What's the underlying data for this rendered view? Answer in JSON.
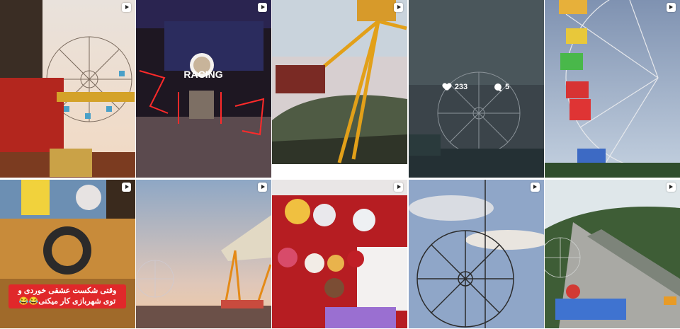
{
  "grid": {
    "tiles": [
      {
        "id": "t1",
        "subject": "ferris wheel and ride close-up",
        "is_reel": true
      },
      {
        "id": "t2",
        "subject": "racing arcade entrance neon",
        "is_reel": true,
        "sign_text": "RACING"
      },
      {
        "id": "t3",
        "subject": "pendulum swing ride",
        "is_reel": true
      },
      {
        "id": "t4",
        "subject": "ferris wheel at dusk",
        "is_reel": false,
        "likes": "233",
        "comments": "5"
      },
      {
        "id": "t5",
        "subject": "colorful ferris wheel cabins",
        "is_reel": true
      },
      {
        "id": "t6",
        "subject": "arcade driving game",
        "is_reel": true,
        "caption": "وقتی شکست عشقی خوردی و توی شهربازی کار میکنی😂😂"
      },
      {
        "id": "t7",
        "subject": "park at sunset",
        "is_reel": true
      },
      {
        "id": "t8",
        "subject": "plush toy prize booth",
        "is_reel": true
      },
      {
        "id": "t9",
        "subject": "ferris wheel under clouds",
        "is_reel": true
      },
      {
        "id": "t10",
        "subject": "aerial view of park and road",
        "is_reel": true
      }
    ]
  },
  "colors": {
    "reel_icon": "#ffffff",
    "caption_bg": "#e0282a",
    "neon_red": "#ff2a2a"
  },
  "icons": [
    "reel-icon",
    "heart-icon",
    "comment-icon"
  ]
}
